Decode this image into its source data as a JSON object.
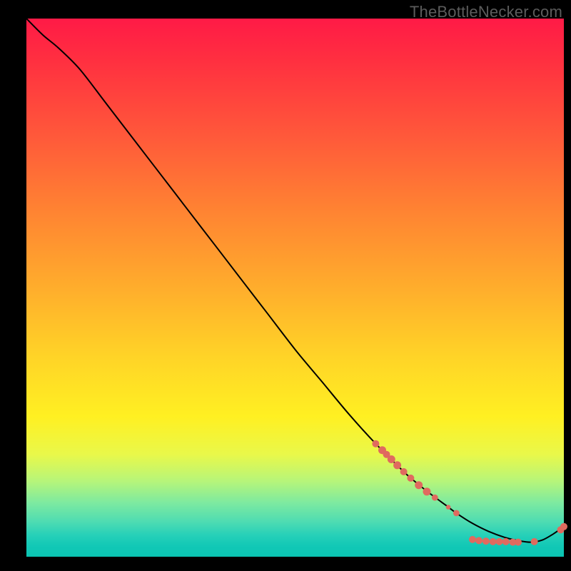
{
  "watermark": "TheBottleNecker.com",
  "colors": {
    "line": "#000000",
    "marker": "#e06a5f",
    "markerStroke": "#8a3a34"
  },
  "chart_data": {
    "type": "line",
    "title": "",
    "xlabel": "",
    "ylabel": "",
    "xlim": [
      0,
      100
    ],
    "ylim": [
      0,
      100
    ],
    "series": [
      {
        "name": "curve",
        "x": [
          0,
          3,
          6,
          10,
          15,
          20,
          25,
          30,
          35,
          40,
          45,
          50,
          55,
          60,
          65,
          70,
          72,
          75,
          78,
          80,
          83,
          86,
          89,
          92,
          94,
          96,
          98,
          100
        ],
        "y": [
          100,
          97,
          94.5,
          90.5,
          84,
          77.5,
          71,
          64.5,
          58,
          51.5,
          45,
          38.5,
          32.5,
          26.5,
          21,
          16,
          14.2,
          11.8,
          9.6,
          8.1,
          6.2,
          4.7,
          3.6,
          2.9,
          2.7,
          3.1,
          4.2,
          5.6
        ]
      }
    ],
    "markers": [
      {
        "x": 65.0,
        "y": 21.0,
        "r": 0.9
      },
      {
        "x": 66.2,
        "y": 19.8,
        "r": 1.0
      },
      {
        "x": 67.0,
        "y": 19.0,
        "r": 0.9
      },
      {
        "x": 67.9,
        "y": 18.1,
        "r": 1.0
      },
      {
        "x": 69.0,
        "y": 17.0,
        "r": 1.0
      },
      {
        "x": 70.2,
        "y": 15.8,
        "r": 0.9
      },
      {
        "x": 71.5,
        "y": 14.6,
        "r": 0.9
      },
      {
        "x": 73.0,
        "y": 13.3,
        "r": 1.0
      },
      {
        "x": 74.5,
        "y": 12.1,
        "r": 1.0
      },
      {
        "x": 76.0,
        "y": 11.0,
        "r": 0.8
      },
      {
        "x": 78.5,
        "y": 9.2,
        "r": 0.6
      },
      {
        "x": 80.0,
        "y": 8.1,
        "r": 0.8
      },
      {
        "x": 83.0,
        "y": 3.2,
        "r": 0.9
      },
      {
        "x": 84.2,
        "y": 3.0,
        "r": 0.9
      },
      {
        "x": 85.5,
        "y": 2.9,
        "r": 0.9
      },
      {
        "x": 86.8,
        "y": 2.8,
        "r": 0.9
      },
      {
        "x": 88.0,
        "y": 2.8,
        "r": 0.9
      },
      {
        "x": 89.2,
        "y": 2.8,
        "r": 0.9
      },
      {
        "x": 90.5,
        "y": 2.7,
        "r": 0.9
      },
      {
        "x": 91.5,
        "y": 2.7,
        "r": 0.9
      },
      {
        "x": 94.5,
        "y": 2.8,
        "r": 0.9
      },
      {
        "x": 99.4,
        "y": 5.0,
        "r": 0.9
      },
      {
        "x": 100.0,
        "y": 5.6,
        "r": 0.9
      }
    ]
  }
}
